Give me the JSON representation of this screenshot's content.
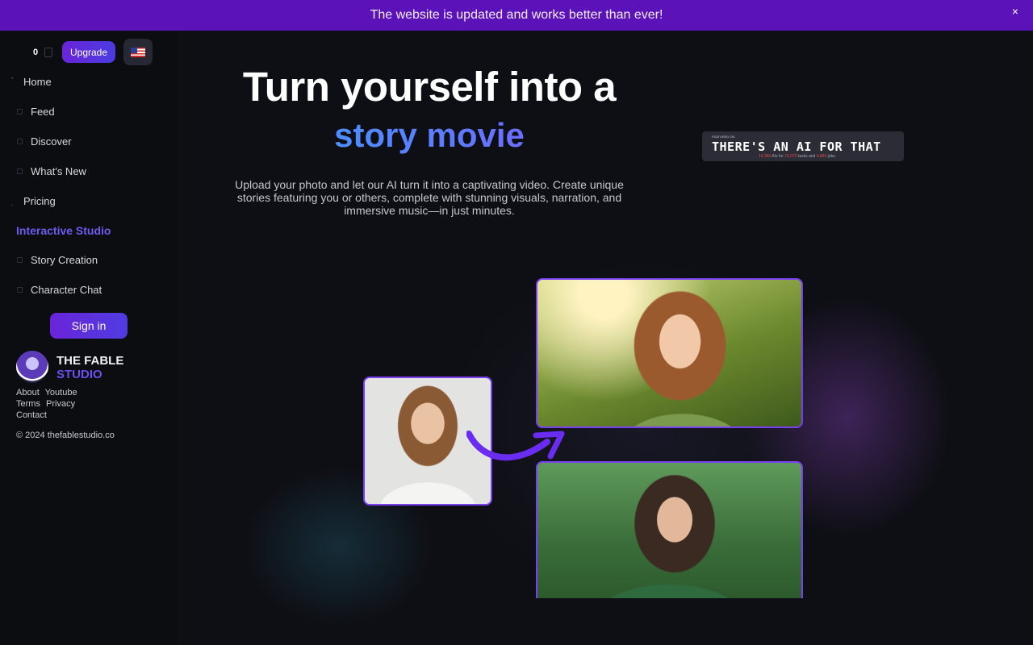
{
  "banner": {
    "message": "The website is updated and works better than ever!",
    "close": "×"
  },
  "topbar": {
    "credits": "0",
    "upgrade_label": "Upgrade",
    "language_flag": "us-flag-icon"
  },
  "nav": {
    "items": [
      {
        "label": "Home"
      },
      {
        "label": "Feed"
      },
      {
        "label": "Discover"
      },
      {
        "label": "What's New"
      },
      {
        "label": "Pricing"
      }
    ],
    "section_title": "Interactive Studio",
    "studio_items": [
      {
        "label": "Story Creation"
      },
      {
        "label": "Character Chat"
      }
    ],
    "signin_label": "Sign in"
  },
  "brand": {
    "line1": "THE FABLE",
    "line2": "STUDIO"
  },
  "footer": {
    "links": [
      "About",
      "Youtube",
      "Terms",
      "Privacy",
      "Contact"
    ],
    "copyright": "© 2024 thefablestudio.co"
  },
  "hero": {
    "title": "Turn yourself into a",
    "subtitle": "story movie",
    "description": "Upload your photo and let our AI turn it into a captivating video. Create unique stories featuring you or others, complete with stunning visuals, narration, and immersive music—in just minutes."
  },
  "badge": {
    "small": "FEATURED ON",
    "title": "THERE'S AN AI FOR THAT",
    "stats_n1": "14,360",
    "stats_t1": " AIs for ",
    "stats_n2": "15,075",
    "stats_t2": " tasks and ",
    "stats_n3": "4,883",
    "stats_t3": " jobs."
  },
  "colors": {
    "banner": "#5b12b8",
    "accent": "#6d5cf0",
    "gradient_start": "#3aa0ff",
    "gradient_end": "#7c5cff",
    "photo_border": "#7b3ff2"
  }
}
